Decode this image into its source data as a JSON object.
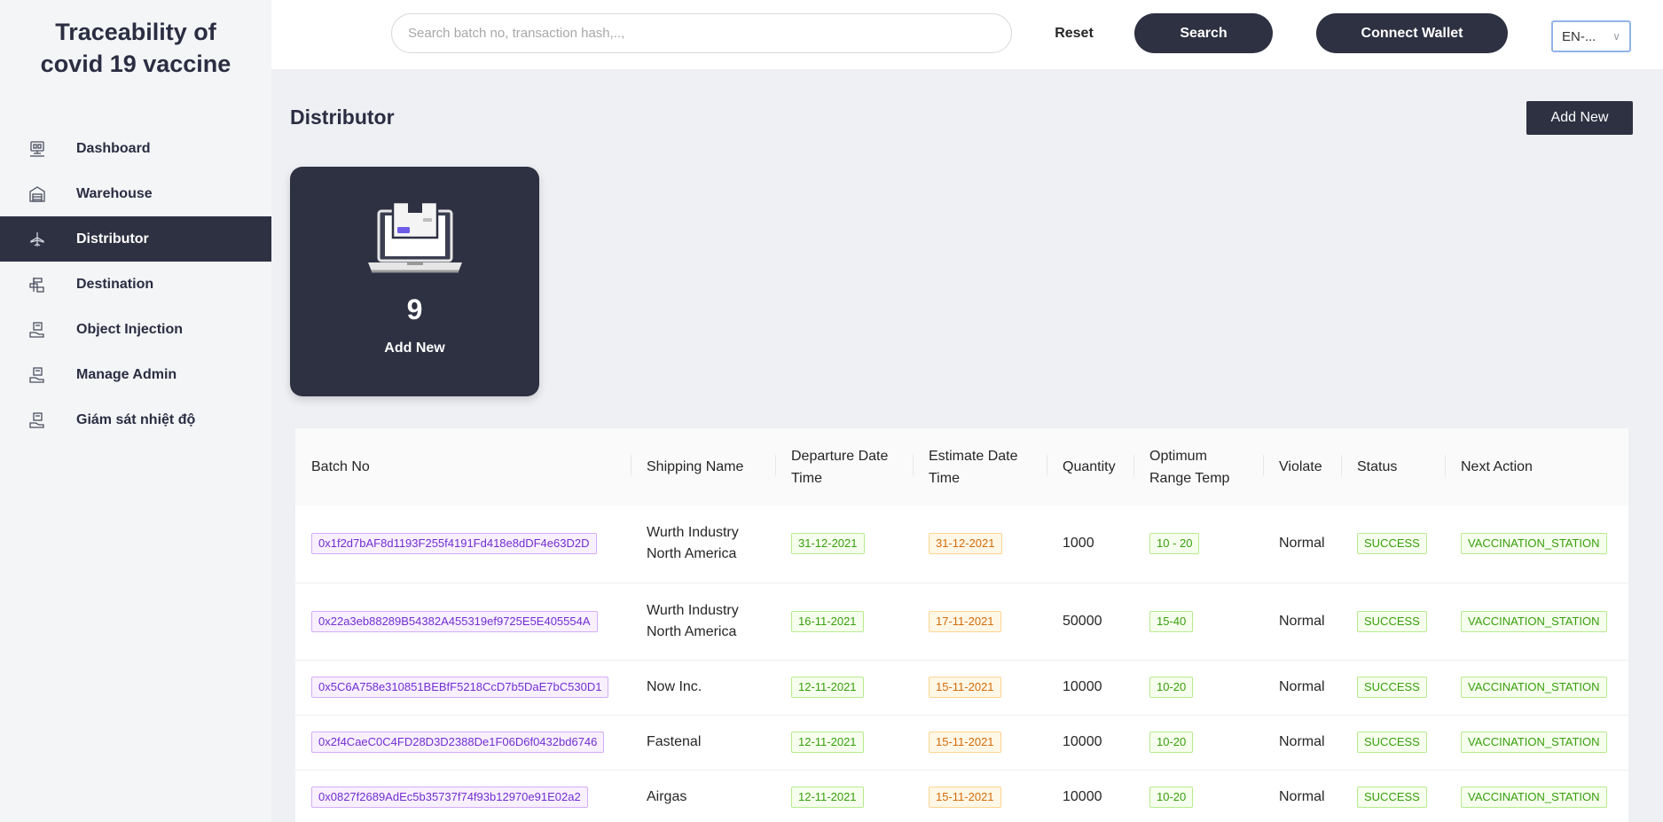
{
  "app": {
    "title": "Traceability of covid 19 vaccine",
    "title_line1": "Traceability of",
    "title_line2": "covid 19 vaccine"
  },
  "sidebar": {
    "items": [
      {
        "label": "Dashboard",
        "icon": "dashboard-icon",
        "active": false
      },
      {
        "label": "Warehouse",
        "icon": "warehouse-icon",
        "active": false
      },
      {
        "label": "Distributor",
        "icon": "distributor-icon",
        "active": true
      },
      {
        "label": "Destination",
        "icon": "destination-icon",
        "active": false
      },
      {
        "label": "Object Injection",
        "icon": "injection-icon",
        "active": false
      },
      {
        "label": "Manage Admin",
        "icon": "admin-icon",
        "active": false
      },
      {
        "label": "Giám sát nhiệt độ",
        "icon": "temperature-icon",
        "active": false
      }
    ]
  },
  "header": {
    "search_placeholder": "Search batch no, transaction hash,..,",
    "search_value": "",
    "reset_label": "Reset",
    "search_label": "Search",
    "wallet_label": "Connect Wallet",
    "language": "EN-..."
  },
  "main": {
    "page_title": "Distributor",
    "add_new_label": "Add New",
    "card": {
      "count": "9",
      "label": "Add New",
      "icon": "laptop-package-icon"
    }
  },
  "table": {
    "columns": [
      "Batch No",
      "Shipping Name",
      "Departure Date Time",
      "Estimate Date Time",
      "Quantity",
      "Optimum Range Temp",
      "Violate",
      "Status",
      "Next Action"
    ],
    "rows": [
      {
        "batch_no": "0x1f2d7bAF8d1193F255f4191Fd418e8dDF4e63D2D",
        "shipping_name": "Wurth Industry North America",
        "departure": "31-12-2021",
        "estimate": "31-12-2021",
        "quantity": "1000",
        "temp": "10 - 20",
        "violate": "Normal",
        "status": "SUCCESS",
        "next_action": "VACCINATION_STATION"
      },
      {
        "batch_no": "0x22a3eb88289B54382A455319ef9725E5E405554A",
        "shipping_name": "Wurth Industry North America",
        "departure": "16-11-2021",
        "estimate": "17-11-2021",
        "quantity": "50000",
        "temp": "15-40",
        "violate": "Normal",
        "status": "SUCCESS",
        "next_action": "VACCINATION_STATION"
      },
      {
        "batch_no": "0x5C6A758e310851BEBfF5218CcD7b5DaE7bC530D1",
        "shipping_name": "Now Inc.",
        "departure": "12-11-2021",
        "estimate": "15-11-2021",
        "quantity": "10000",
        "temp": "10-20",
        "violate": "Normal",
        "status": "SUCCESS",
        "next_action": "VACCINATION_STATION"
      },
      {
        "batch_no": "0x2f4CaeC0C4FD28D3D2388De1F06D6f0432bd6746",
        "shipping_name": "Fastenal",
        "departure": "12-11-2021",
        "estimate": "15-11-2021",
        "quantity": "10000",
        "temp": "10-20",
        "violate": "Normal",
        "status": "SUCCESS",
        "next_action": "VACCINATION_STATION"
      },
      {
        "batch_no": "0x0827f2689AdEc5b35737f74f93b12970e91E02a2",
        "shipping_name": "Airgas",
        "departure": "12-11-2021",
        "estimate": "15-11-2021",
        "quantity": "10000",
        "temp": "10-20",
        "violate": "Normal",
        "status": "SUCCESS",
        "next_action": "VACCINATION_STATION"
      }
    ]
  },
  "colors": {
    "primary_dark": "#2d3142",
    "tag_purple": "#722ed1",
    "tag_green": "#389e0d",
    "tag_orange": "#d46b08"
  }
}
